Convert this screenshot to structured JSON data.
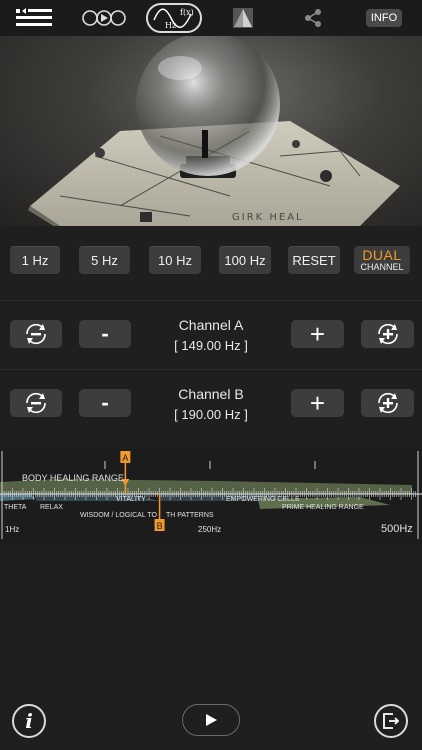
{
  "topbar": {
    "icons": [
      "menu-list-icon",
      "binaural-loop-icon",
      "hz-function-icon",
      "pyramid-icon",
      "share-icon"
    ],
    "hz_icon_text": {
      "fx": "f(x)",
      "hz": "Hz"
    },
    "info_label": "INFO"
  },
  "frequency_steps": {
    "buttons": [
      "1 Hz",
      "5 Hz",
      "10 Hz",
      "100 Hz"
    ],
    "reset_label": "RESET",
    "dual_label_top": "DUAL",
    "dual_label_bottom": "CHANNEL"
  },
  "channel_a": {
    "title": "Channel A",
    "value": "[ 149.00 Hz ]",
    "minus": "-",
    "plus": "+"
  },
  "channel_b": {
    "title": "Channel B",
    "value": "[ 190.00 Hz ]",
    "minus": "-",
    "plus": "+"
  },
  "spectrum": {
    "body_healing": "BODY HEALING RANGE",
    "theta": "THETA",
    "relax": "RELAX",
    "vitality": "VITALITY",
    "empowering": "EMPOWERING CELLS",
    "wisdom": "WISDOM / LOGICAL TO",
    "patterns": "TH PATTERNS",
    "prime": "PRIME HEALING RANGE",
    "tick_1": "1Hz",
    "tick_250": "250Hz",
    "tick_500": "500Hz",
    "marker_a": "A",
    "marker_b": "B",
    "marker_a_hz": 149,
    "marker_b_hz": 190,
    "colors": {
      "marker": "#f39a2c",
      "band_green": "#5f6f4e",
      "band_blue": "#4a6b7a"
    }
  },
  "photo": {
    "engraving": "GIRK HEAL"
  },
  "bottom": {
    "info_icon": "i",
    "play_icon": "play-icon",
    "exit_icon": "exit-icon"
  },
  "colors": {
    "accent": "#f39a2c",
    "button_bg": "#3c3c3c",
    "background": "#1f1f1f"
  }
}
